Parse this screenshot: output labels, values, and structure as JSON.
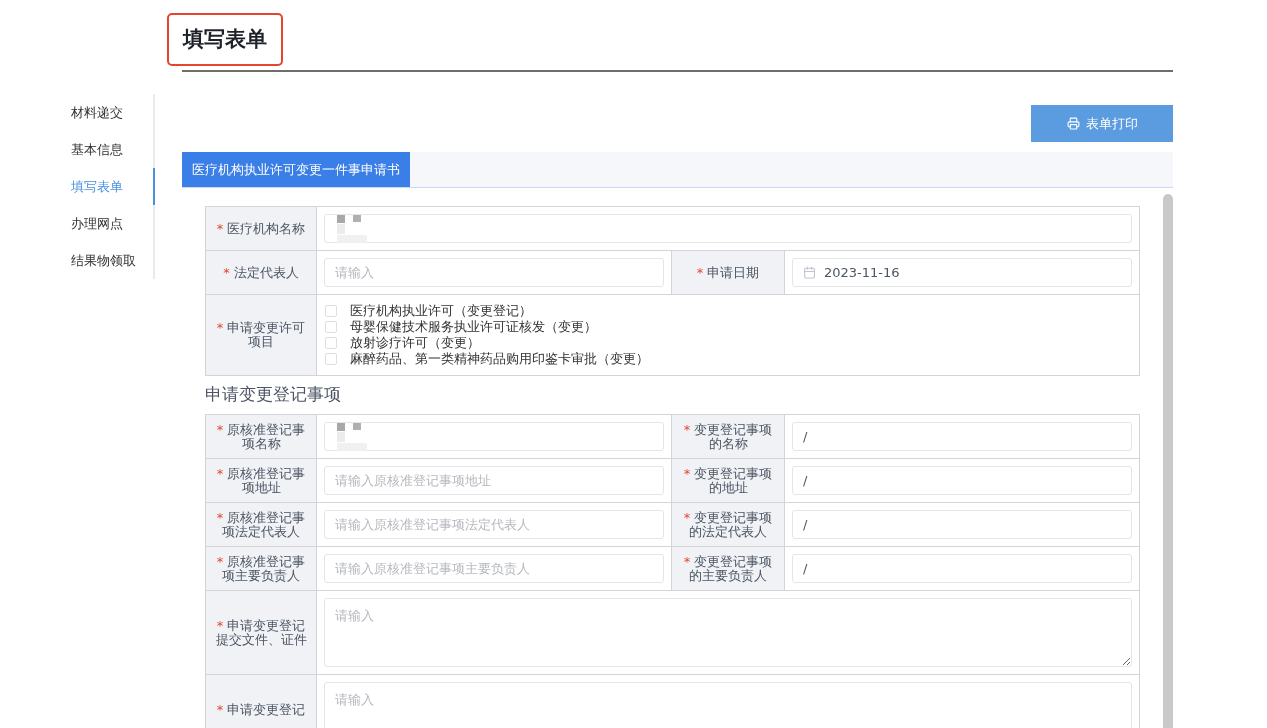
{
  "page_title": "填写表单",
  "sidebar": {
    "items": [
      {
        "label": "材料递交",
        "selected": false
      },
      {
        "label": "基本信息",
        "selected": false
      },
      {
        "label": "填写表单",
        "selected": true
      },
      {
        "label": "办理网点",
        "selected": false
      },
      {
        "label": "结果物领取",
        "selected": false
      }
    ]
  },
  "print_button": {
    "label": "表单打印"
  },
  "tabs": [
    {
      "label": "医疗机构执业许可变更一件事申请书",
      "selected": true
    }
  ],
  "basic_rows": [
    {
      "kind": "wide",
      "fields": [
        {
          "marker": "*",
          "label": "医疗机构名称",
          "kind": "text",
          "redacted": true
        }
      ]
    },
    {
      "kind": "pair",
      "fields": [
        {
          "marker": "*",
          "label": "法定代表人",
          "kind": "text",
          "placeholder": "请输入"
        },
        {
          "marker": "*",
          "label": "申请日期",
          "kind": "date",
          "value": "2023-11-16"
        }
      ]
    },
    {
      "kind": "checklist",
      "marker": "*",
      "label": "申请变更许可项目",
      "options": [
        {
          "label": "医疗机构执业许可（变更登记）",
          "checked": false
        },
        {
          "label": "母婴保健技术服务执业许可证核发（变更）",
          "checked": false
        },
        {
          "label": "放射诊疗许可（变更）",
          "checked": false
        },
        {
          "label": "麻醉药品、第一类精神药品购用印鉴卡审批（变更）",
          "checked": false
        }
      ]
    }
  ],
  "section_title": "申请变更登记事项",
  "change_rows": [
    {
      "kind": "pair",
      "fields": [
        {
          "marker": "*",
          "label": "原核准登记事项名称",
          "kind": "text",
          "redacted": true
        },
        {
          "marker": "*",
          "label": "变更登记事项的名称",
          "kind": "text",
          "value": "/"
        }
      ]
    },
    {
      "kind": "pair",
      "fields": [
        {
          "marker": "*",
          "label": "原核准登记事项地址",
          "kind": "text",
          "placeholder": "请输入原核准登记事项地址"
        },
        {
          "marker": "*",
          "label": "变更登记事项的地址",
          "kind": "text",
          "value": "/"
        }
      ]
    },
    {
      "kind": "pair",
      "fields": [
        {
          "marker": "*",
          "label": "原核准登记事项法定代表人",
          "kind": "text",
          "placeholder": "请输入原核准登记事项法定代表人"
        },
        {
          "marker": "*",
          "label": "变更登记事项的法定代表人",
          "kind": "text",
          "value": "/"
        }
      ]
    },
    {
      "kind": "pair",
      "fields": [
        {
          "marker": "*",
          "label": "原核准登记事项主要负责人",
          "kind": "text",
          "placeholder": "请输入原核准登记事项主要负责人"
        },
        {
          "marker": "*",
          "label": "变更登记事项的主要负责人",
          "kind": "text",
          "value": "/"
        }
      ]
    },
    {
      "kind": "wide",
      "fields": [
        {
          "marker": "*",
          "label": "申请变更登记提交文件、证件",
          "kind": "textarea",
          "placeholder": "请输入"
        }
      ]
    },
    {
      "kind": "wide",
      "fields": [
        {
          "marker": "*",
          "label": "申请变更登记",
          "kind": "textarea",
          "placeholder": "请输入"
        }
      ]
    }
  ]
}
